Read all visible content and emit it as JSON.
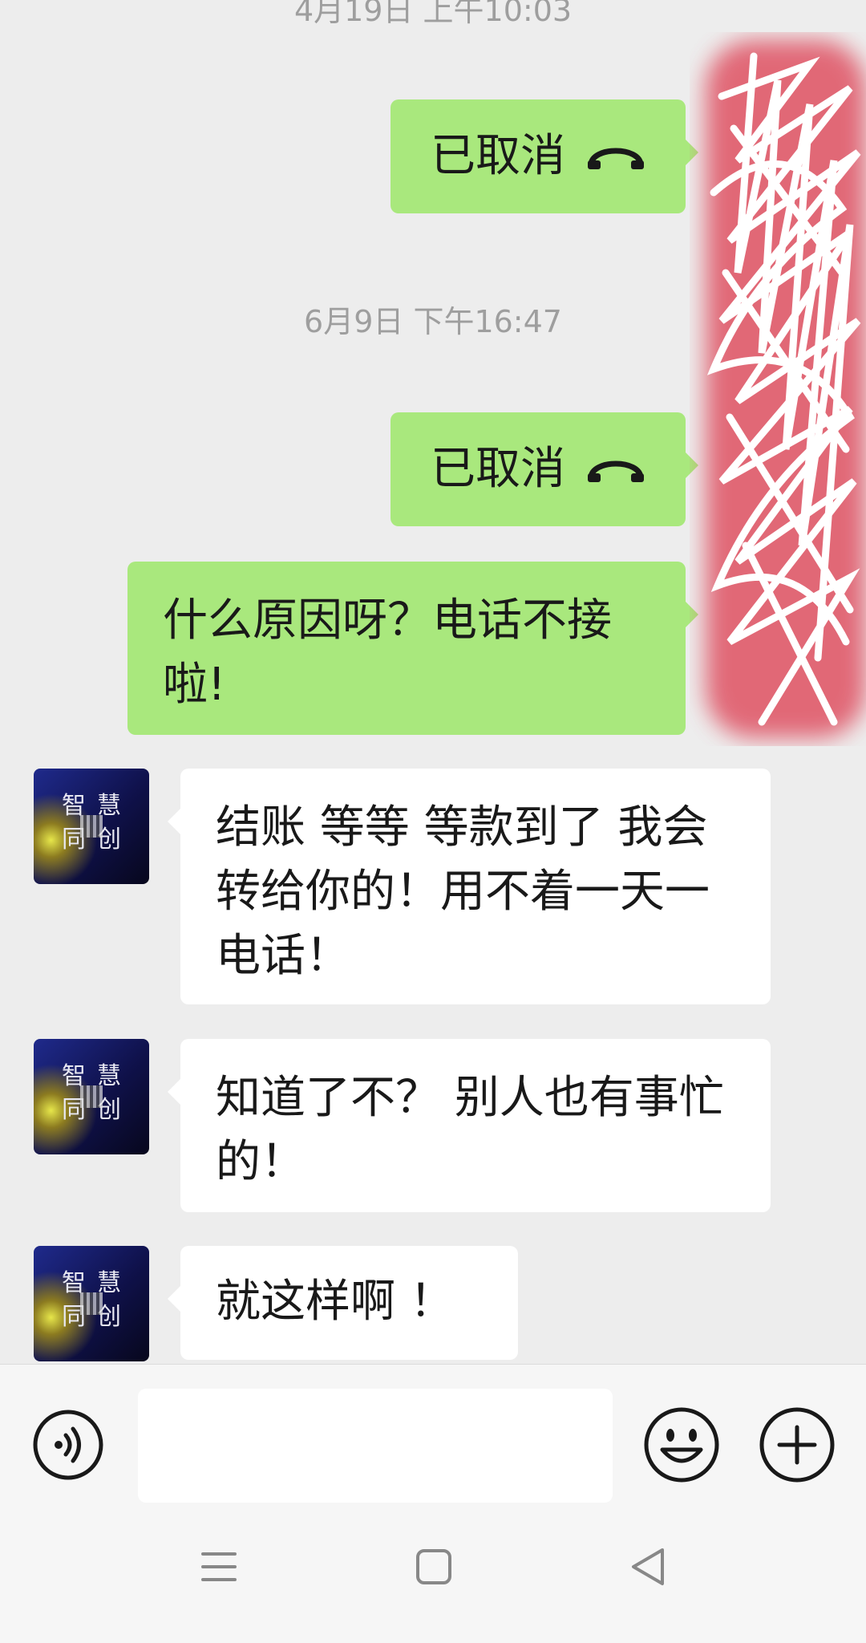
{
  "timestamps": [
    "4月19日 上午10:03",
    "6月9日 下午16:47"
  ],
  "messages": [
    {
      "side": "me",
      "type": "call",
      "text": "已取消",
      "icon": "hangup-icon"
    },
    {
      "side": "me",
      "type": "call",
      "text": "已取消",
      "icon": "hangup-icon"
    },
    {
      "side": "me",
      "type": "text",
      "text": "什么原因呀？电话不接啦!"
    },
    {
      "side": "them",
      "type": "text",
      "text": "结账  等等  等款到了 我会转给你的！用不着一天一电话！"
    },
    {
      "side": "them",
      "type": "text",
      "text": "知道了不？ 别人也有事忙的！"
    },
    {
      "side": "them",
      "type": "text",
      "text": "就这样啊 ！"
    }
  ],
  "avatar": {
    "chars": [
      "智",
      "慧",
      "同",
      "创"
    ]
  },
  "colors": {
    "background": "#ededed",
    "my_bubble": "#a9e87d",
    "their_bubble": "#ffffff",
    "redaction": "#e05a6a"
  },
  "input": {
    "value": ""
  },
  "icons": {
    "voice": "voice-icon",
    "emoji": "emoji-icon",
    "add": "plus-icon",
    "nav": [
      "menu-icon",
      "home-icon",
      "back-icon"
    ]
  }
}
